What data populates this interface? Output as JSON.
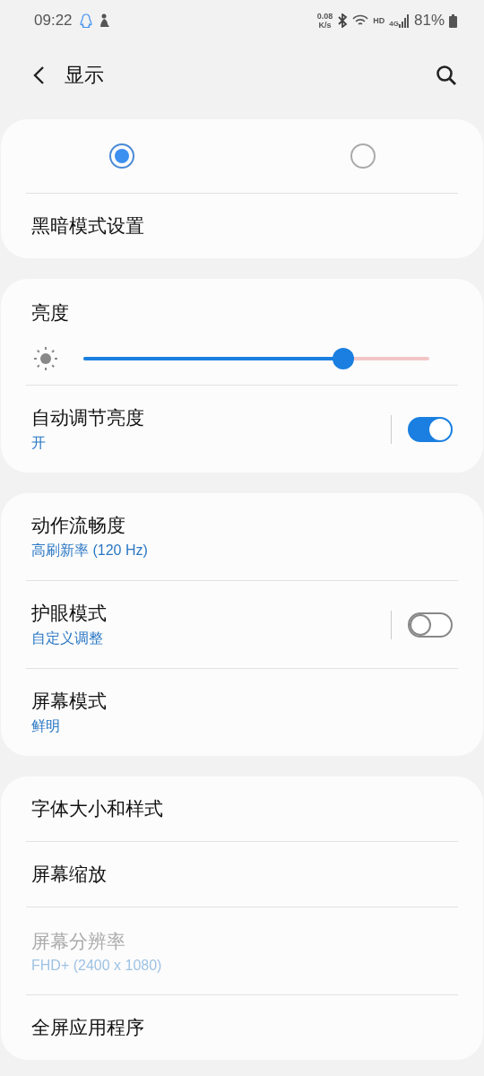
{
  "status_bar": {
    "time": "09:22",
    "net_speed_value": "0.08",
    "net_speed_unit": "K/s",
    "hd_label": "HD",
    "network_type": "4G",
    "battery": "81%"
  },
  "header": {
    "title": "显示"
  },
  "dark_mode": {
    "options": [
      {
        "selected": true
      },
      {
        "selected": false
      }
    ],
    "label": "黑暗模式设置"
  },
  "brightness": {
    "title": "亮度",
    "level": 0.75,
    "auto": {
      "title": "自动调节亮度",
      "subtitle": "开",
      "on": true
    }
  },
  "groups": [
    {
      "items": [
        {
          "kind": "text",
          "title": "动作流畅度",
          "subtitle": "高刷新率 (120 Hz)",
          "disabled": false
        },
        {
          "kind": "switch",
          "title": "护眼模式",
          "subtitle": "自定义调整",
          "on": false,
          "disabled": false
        },
        {
          "kind": "text",
          "title": "屏幕模式",
          "subtitle": "鲜明",
          "disabled": false
        }
      ]
    },
    {
      "items": [
        {
          "kind": "text",
          "title": "字体大小和样式",
          "disabled": false
        },
        {
          "kind": "text",
          "title": "屏幕缩放",
          "disabled": false
        },
        {
          "kind": "text",
          "title": "屏幕分辨率",
          "subtitle": "FHD+ (2400 x 1080)",
          "disabled": true
        },
        {
          "kind": "text",
          "title": "全屏应用程序",
          "disabled": false
        }
      ]
    }
  ]
}
